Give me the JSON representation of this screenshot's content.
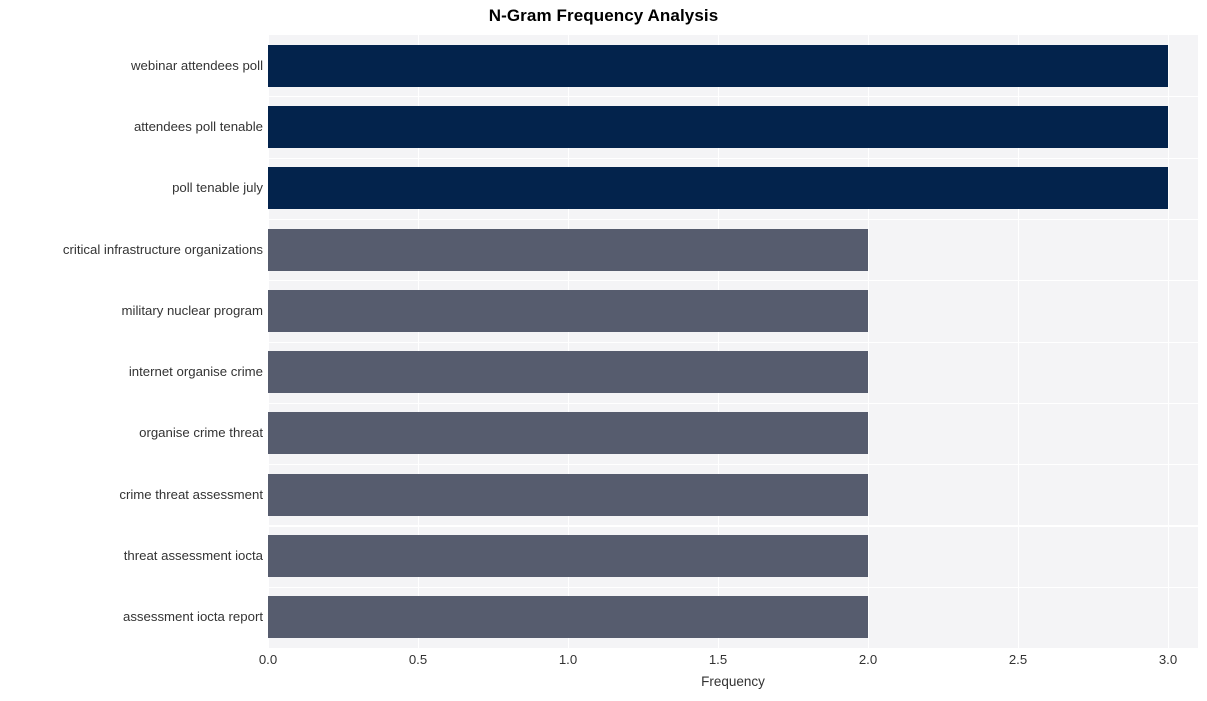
{
  "chart_data": {
    "type": "bar",
    "orientation": "horizontal",
    "title": "N-Gram Frequency Analysis",
    "xlabel": "Frequency",
    "ylabel": "",
    "categories": [
      "webinar attendees poll",
      "attendees poll tenable",
      "poll tenable july",
      "critical infrastructure organizations",
      "military nuclear program",
      "internet organise crime",
      "organise crime threat",
      "crime threat assessment",
      "threat assessment iocta",
      "assessment iocta report"
    ],
    "values": [
      3,
      3,
      3,
      2,
      2,
      2,
      2,
      2,
      2,
      2
    ],
    "bar_colors": [
      "#03234c",
      "#03234c",
      "#03234c",
      "#565c6e",
      "#565c6e",
      "#565c6e",
      "#565c6e",
      "#565c6e",
      "#565c6e",
      "#565c6e"
    ],
    "xlim": [
      0.0,
      3.1
    ],
    "ylim_count": 10,
    "xticks": [
      "0.0",
      "0.5",
      "1.0",
      "1.5",
      "2.0",
      "2.5",
      "3.0"
    ],
    "xtick_values": [
      0.0,
      0.5,
      1.0,
      1.5,
      2.0,
      2.5,
      3.0
    ],
    "grid": true,
    "grid_color": "#ffffff",
    "plot_background": "#f4f4f6",
    "figure_background": "#ffffff",
    "legend": null,
    "tick_label_color": "#333333",
    "title_color": "#000000"
  }
}
